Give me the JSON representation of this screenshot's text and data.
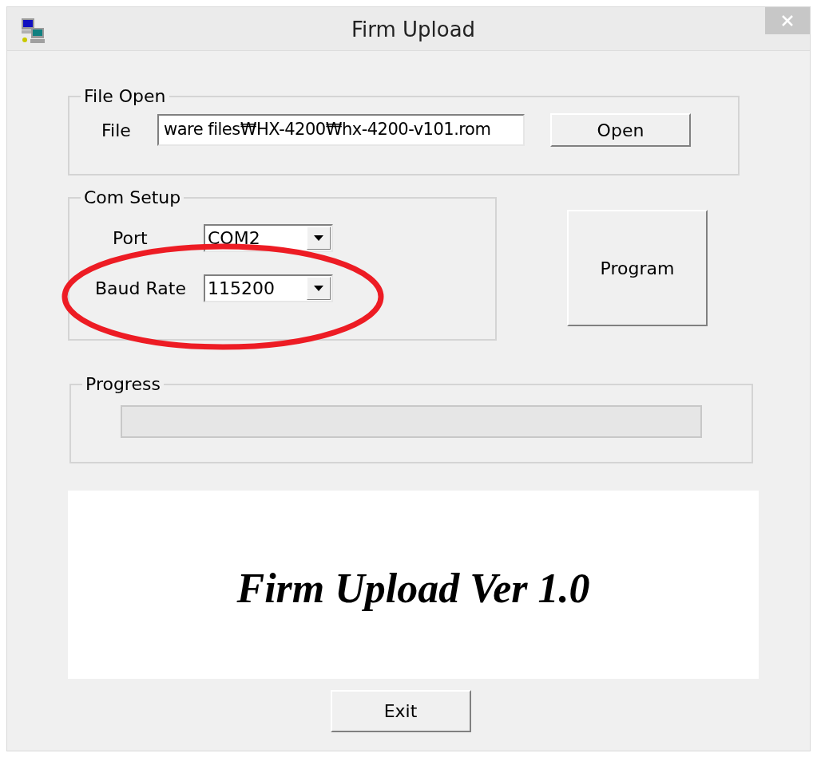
{
  "window": {
    "title": "Firm Upload"
  },
  "file_open": {
    "title": "File Open",
    "label": "File",
    "value": "ware files₩HX-4200₩hx-4200-v101.rom",
    "button": "Open"
  },
  "com_setup": {
    "title": "Com Setup",
    "port_label": "Port",
    "port_value": "COM2",
    "baud_label": "Baud Rate",
    "baud_value": "115200"
  },
  "program_button": "Program",
  "progress": {
    "title": "Progress",
    "level": 0
  },
  "banner": "Firm Upload Ver 1.0",
  "exit_button": "Exit"
}
